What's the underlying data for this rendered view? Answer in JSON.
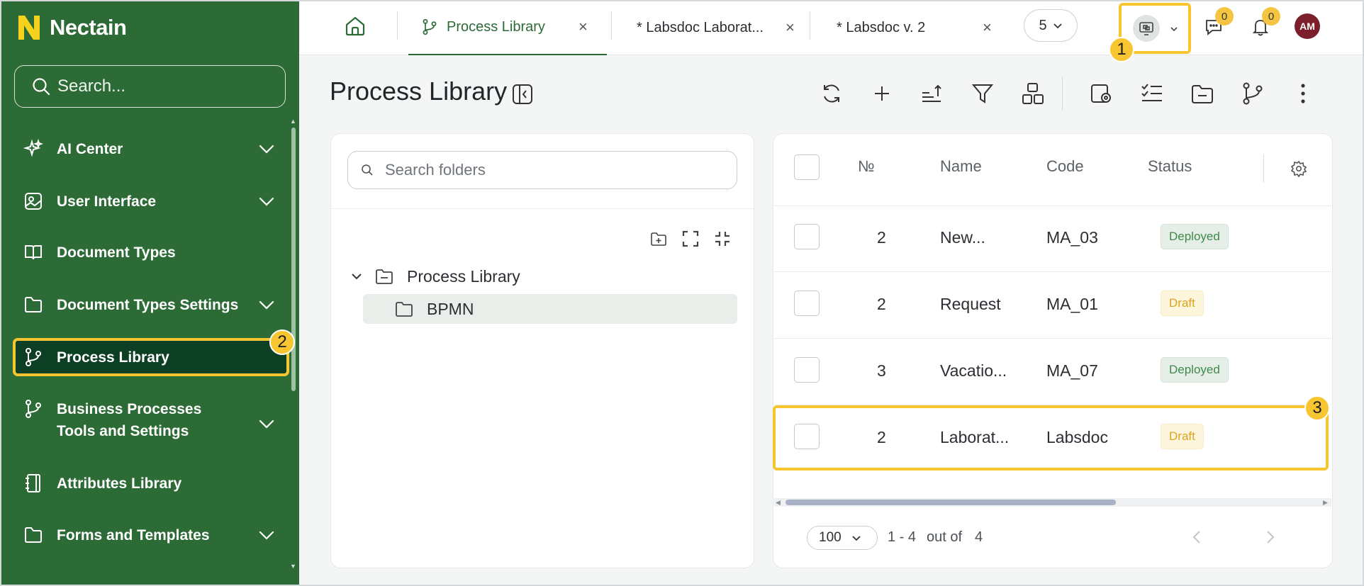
{
  "app": {
    "brand": "Nectain",
    "brand_color": "#2d6b36",
    "accent": "#f7c530"
  },
  "sidebar": {
    "search_placeholder": "Search...",
    "items": [
      {
        "label": "AI Center",
        "icon": "sparkle-icon",
        "expandable": true
      },
      {
        "label": "User Interface",
        "icon": "image-icon",
        "expandable": true
      },
      {
        "label": "Document Types",
        "icon": "book-icon",
        "expandable": false
      },
      {
        "label": "Document Types Settings",
        "icon": "folder-icon",
        "expandable": true
      },
      {
        "label": "Process Library",
        "icon": "branch-icon",
        "expandable": false,
        "active": true
      },
      {
        "label": "Business Processes Tools and Settings",
        "icon": "branch-icon",
        "expandable": true
      },
      {
        "label": "Attributes Library",
        "icon": "notebook-icon",
        "expandable": false
      },
      {
        "label": "Forms and Templates",
        "icon": "folder-icon",
        "expandable": true
      }
    ]
  },
  "tabs": [
    {
      "label": "Process Library",
      "active": true
    },
    {
      "label": "* Labsdoc Laborat...",
      "active": false
    },
    {
      "label": "* Labsdoc v. 2",
      "active": false
    }
  ],
  "tab_overflow_count": "5",
  "notifications": {
    "messages": "0",
    "alerts": "0"
  },
  "user": {
    "initials": "AM"
  },
  "callouts": [
    "1",
    "2",
    "3"
  ],
  "page": {
    "title": "Process Library"
  },
  "folders": {
    "search_placeholder": "Search folders",
    "tree": [
      {
        "label": "Process Library",
        "level": 0,
        "expanded": true
      },
      {
        "label": "BPMN",
        "level": 1,
        "selected": true
      }
    ]
  },
  "table": {
    "columns": [
      "№",
      "Name",
      "Code",
      "Status"
    ],
    "rows": [
      {
        "no": "2",
        "name": "New...",
        "code": "MA_03",
        "status": "Deployed"
      },
      {
        "no": "2",
        "name": "Request",
        "code": "MA_01",
        "status": "Draft"
      },
      {
        "no": "3",
        "name": "Vacatio...",
        "code": "MA_07",
        "status": "Deployed"
      },
      {
        "no": "2",
        "name": "Laborat...",
        "code": "Labsdoc",
        "status": "Draft"
      }
    ]
  },
  "pagination": {
    "page_size": "100",
    "range": "1 - 4",
    "out_of_label": "out of",
    "total": "4"
  }
}
